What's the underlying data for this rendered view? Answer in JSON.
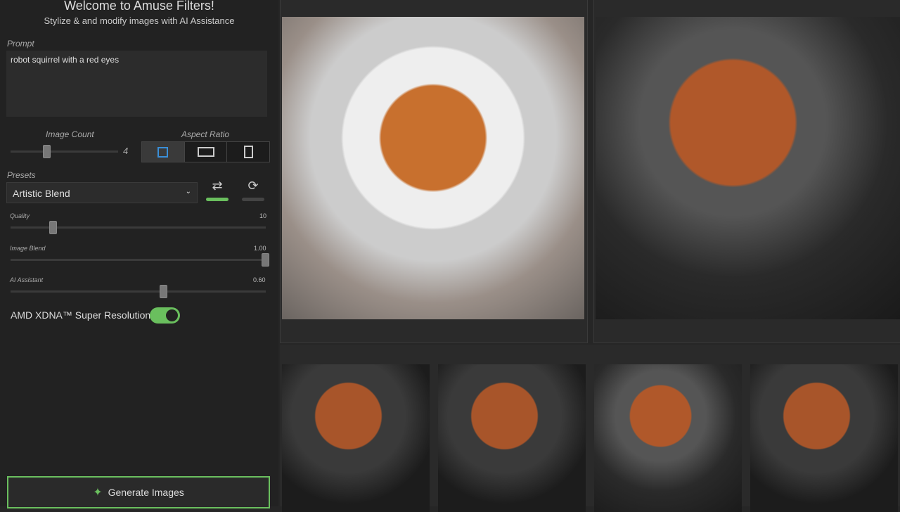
{
  "header": {
    "title": "Welcome to Amuse Filters!",
    "subtitle": "Stylize & and modify images with AI Assistance"
  },
  "prompt": {
    "label": "Prompt",
    "value": "robot squirrel with a red eyes"
  },
  "image_count": {
    "label": "Image Count",
    "value": "4"
  },
  "aspect_ratio": {
    "label": "Aspect Ratio",
    "options": [
      "square",
      "landscape",
      "portrait"
    ],
    "selected": "square"
  },
  "presets": {
    "label": "Presets",
    "selected": "Artistic Blend",
    "shuffle_active": true,
    "refresh_active": false
  },
  "sliders": [
    {
      "label": "Quality",
      "value": "10",
      "fraction": 0.17
    },
    {
      "label": "Image Blend",
      "value": "1.00",
      "fraction": 1.0
    },
    {
      "label": "AI Assistant",
      "value": "0.60",
      "fraction": 0.6
    }
  ],
  "super_resolution": {
    "label": "AMD XDNA™ Super Resolution",
    "enabled": true
  },
  "generate": {
    "label": "Generate Images"
  },
  "colors": {
    "accent": "#6abf5e",
    "selected_aspect": "#3a8fd8"
  }
}
